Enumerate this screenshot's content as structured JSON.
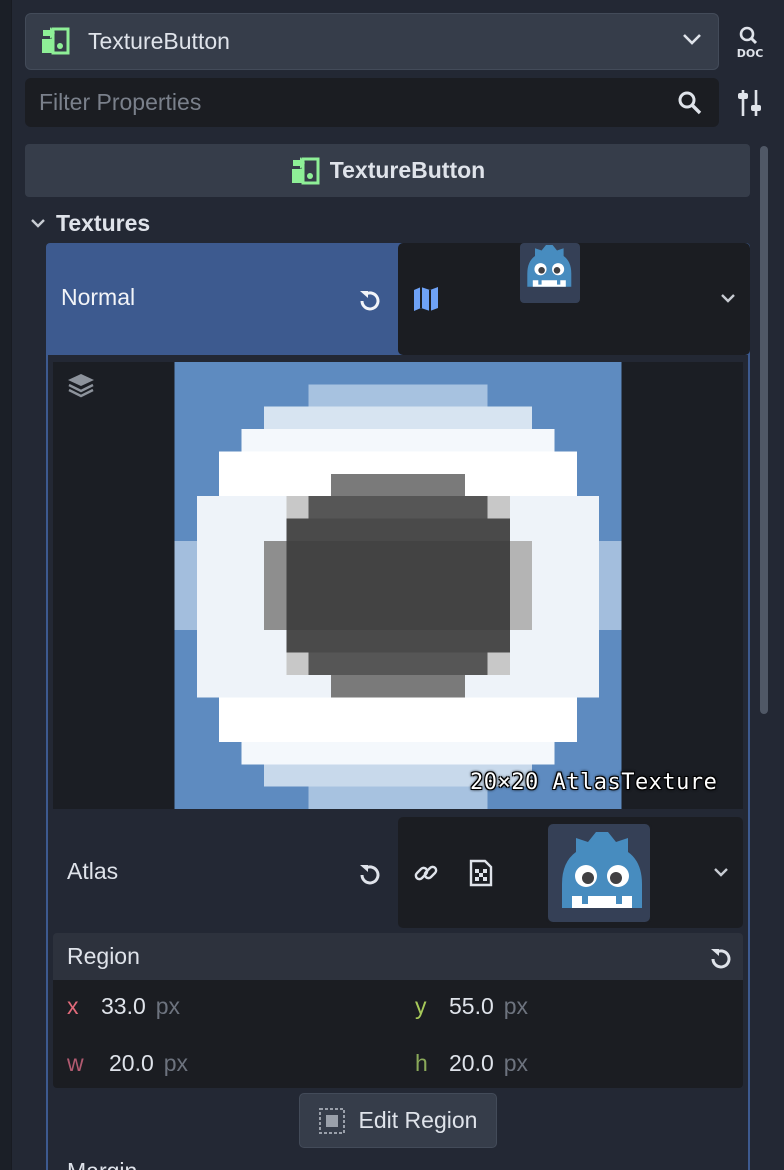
{
  "node_selector": {
    "label": "TextureButton",
    "icon": "texture-button-node-icon"
  },
  "doc_button": {
    "text": "DOC"
  },
  "filter": {
    "placeholder": "Filter Properties",
    "value": ""
  },
  "inspector_header": {
    "label": "TextureButton"
  },
  "section": {
    "label": "Textures"
  },
  "normal": {
    "label": "Normal",
    "resource_icon": "atlas-texture-icon",
    "preview_caption": "20×20 AtlasTexture"
  },
  "atlas": {
    "label": "Atlas"
  },
  "region": {
    "label": "Region",
    "x": {
      "axis": "x",
      "value": "33.0",
      "unit": "px"
    },
    "y": {
      "axis": "y",
      "value": "55.0",
      "unit": "px"
    },
    "w": {
      "axis": "w",
      "value": "20.0",
      "unit": "px"
    },
    "h": {
      "axis": "h",
      "value": "20.0",
      "unit": "px"
    }
  },
  "edit_region": {
    "label": "Edit Region"
  },
  "next_property": {
    "label": "Margin"
  },
  "colors": {
    "background": "#232834",
    "selected_row": "#3d5a8f",
    "node_green": "#8eef97",
    "x_axis": "#e16a7a",
    "y_axis": "#a7c95a",
    "accent_blue": "#6ea2f7"
  }
}
